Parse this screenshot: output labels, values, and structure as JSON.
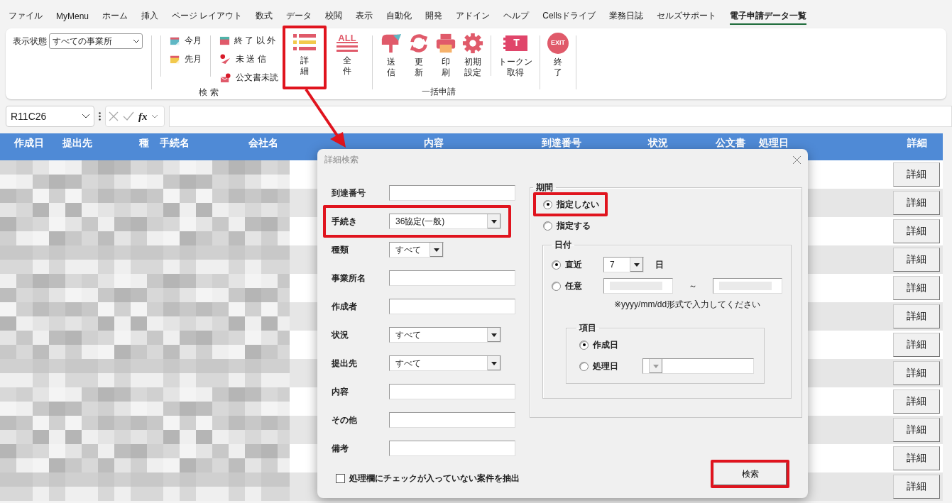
{
  "menu_tabs": [
    {
      "label": "ファイル",
      "selected": false
    },
    {
      "label": "MyMenu",
      "selected": false
    },
    {
      "label": "ホーム",
      "selected": false
    },
    {
      "label": "挿入",
      "selected": false
    },
    {
      "label": "ページ レイアウト",
      "selected": false
    },
    {
      "label": "数式",
      "selected": false
    },
    {
      "label": "データ",
      "selected": false
    },
    {
      "label": "校閲",
      "selected": false
    },
    {
      "label": "表示",
      "selected": false
    },
    {
      "label": "自動化",
      "selected": false
    },
    {
      "label": "開発",
      "selected": false
    },
    {
      "label": "アドイン",
      "selected": false
    },
    {
      "label": "ヘルプ",
      "selected": false
    },
    {
      "label": "Cellsドライブ",
      "selected": false
    },
    {
      "label": "業務日誌",
      "selected": false
    },
    {
      "label": "セルズサポート",
      "selected": false
    },
    {
      "label": "電子申請データ一覧",
      "selected": true
    }
  ],
  "ribbon": {
    "display_state": {
      "label": "表示状態",
      "value": "すべての事業所"
    },
    "search_group": {
      "label": "検 索",
      "small_columns": [
        [
          {
            "label": "今月"
          },
          {
            "label": "先月"
          }
        ],
        [
          {
            "label": "終 了 以 外"
          },
          {
            "label": "未 送 信"
          },
          {
            "label": "公文書未読"
          }
        ]
      ],
      "large_buttons": [
        {
          "lines": [
            "詳",
            "細"
          ],
          "highlighted": true
        },
        {
          "lines": [
            "全",
            "件"
          ],
          "icon_text": "ALL",
          "highlighted": false
        }
      ]
    },
    "batch_group": {
      "label": "一括申請",
      "buttons": [
        {
          "lines": [
            "送",
            "信"
          ]
        },
        {
          "lines": [
            "更",
            "新"
          ]
        },
        {
          "lines": [
            "印",
            "刷"
          ]
        },
        {
          "lines": [
            "初期",
            "設定"
          ]
        },
        {
          "lines": [
            "トークン",
            "取得"
          ],
          "icon_text": "T"
        }
      ]
    },
    "exit_button": {
      "lines": [
        "終",
        "了"
      ],
      "icon_text": "EXIT"
    }
  },
  "formula_bar": {
    "name_box": "R11C26",
    "function_label": "fx"
  },
  "table": {
    "columns": [
      "作成日",
      "提出先",
      "種",
      "手続名",
      "会社名",
      "内容",
      "到達番号",
      "状況",
      "公文書",
      "処理日",
      "詳細"
    ],
    "rows": [
      {
        "button": "詳細"
      },
      {
        "button": "詳細"
      },
      {
        "button": "詳細"
      },
      {
        "button": "詳細"
      },
      {
        "button": "詳細"
      },
      {
        "button": "詳細"
      },
      {
        "button": "詳細"
      },
      {
        "button": "詳細"
      },
      {
        "button": "詳細"
      },
      {
        "button": "詳細"
      },
      {
        "button": "詳細"
      },
      {
        "button": "詳細"
      }
    ]
  },
  "dialog": {
    "title": "詳細検索",
    "fields": [
      {
        "label": "到達番号",
        "kind": "text",
        "highlighted": false
      },
      {
        "label": "手続き",
        "kind": "select",
        "value": "36協定(一般)",
        "highlighted": true
      },
      {
        "label": "種類",
        "kind": "short_select",
        "value": "すべて",
        "highlighted": false
      },
      {
        "label": "事業所名",
        "kind": "text",
        "highlighted": false
      },
      {
        "label": "作成者",
        "kind": "text",
        "highlighted": false
      },
      {
        "label": "状況",
        "kind": "select",
        "value": "すべて",
        "highlighted": false
      },
      {
        "label": "提出先",
        "kind": "select",
        "value": "すべて",
        "highlighted": false
      },
      {
        "label": "内容",
        "kind": "text",
        "highlighted": false
      },
      {
        "label": "その他",
        "kind": "text",
        "highlighted": false
      },
      {
        "label": "備考",
        "kind": "text",
        "highlighted": false
      }
    ],
    "checkbox": {
      "label": "処理欄にチェックが入っていない案件を抽出",
      "checked": false
    },
    "period": {
      "legend": "期間",
      "options": [
        {
          "label": "指定しない",
          "selected": true,
          "highlighted": true
        },
        {
          "label": "指定する",
          "selected": false,
          "highlighted": false
        }
      ],
      "date": {
        "legend": "日付",
        "recent": {
          "label": "直近",
          "selected": true,
          "value": "7",
          "unit": "日"
        },
        "custom": {
          "label": "任意",
          "selected": false,
          "separator": "～"
        },
        "note": "※yyyy/mm/dd形式で入力してください",
        "item": {
          "legend": "項目",
          "options": [
            {
              "label": "作成日",
              "selected": true
            },
            {
              "label": "処理日",
              "selected": false
            }
          ]
        }
      }
    },
    "search_button": {
      "label": "検索",
      "highlighted": true
    }
  }
}
